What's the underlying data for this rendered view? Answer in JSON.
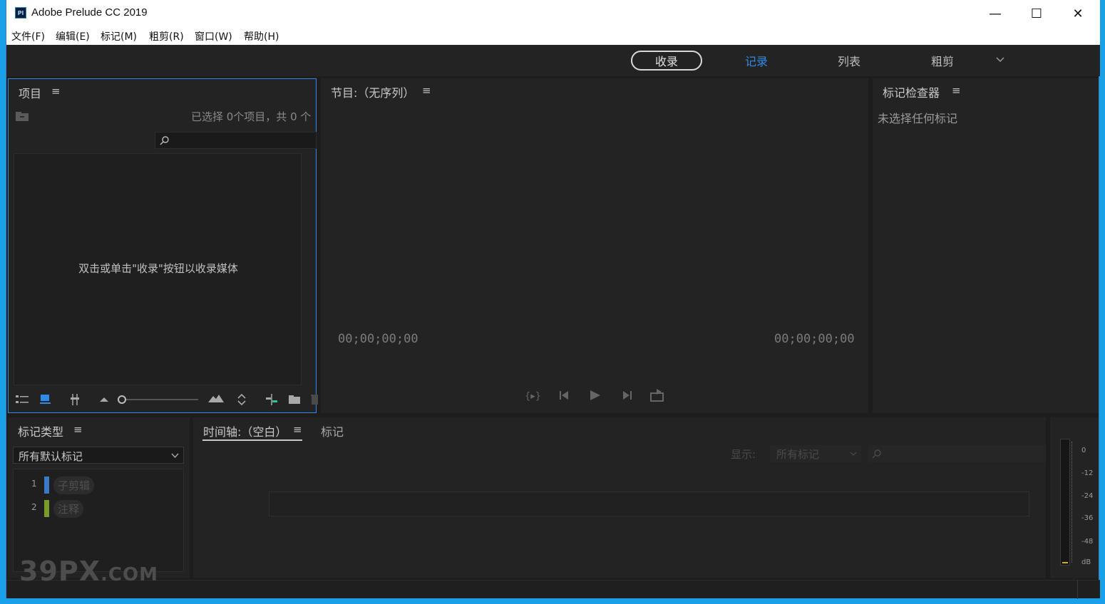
{
  "window": {
    "app_icon": "Pl",
    "title": "Adobe Prelude CC 2019",
    "controls": {
      "minimize": "—",
      "maximize": "☐",
      "close": "✕"
    }
  },
  "menu": [
    "文件(F)",
    "编辑(E)",
    "标记(M)",
    "粗剪(R)",
    "窗口(W)",
    "帮助(H)"
  ],
  "workspaces": {
    "ingest": "收录",
    "tabs": [
      "记录",
      "列表",
      "粗剪"
    ],
    "active": "记录",
    "dropdown_icon": "chevron-down-icon"
  },
  "project": {
    "title": "项目",
    "panel_menu": "≡",
    "selection_status": "已选择 0个项目，共 0 个",
    "search_placeholder": "",
    "empty_message": "双击或单击\"收录\"按钮以收录媒体"
  },
  "program": {
    "title": "节目:（无序列）",
    "panel_menu": "≡",
    "timecode_left": "00;00;00;00",
    "timecode_right": "00;00;00;00"
  },
  "inspector": {
    "title": "标记检查器",
    "panel_menu": "≡",
    "message": "未选择任何标记"
  },
  "marker_types": {
    "title": "标记类型",
    "panel_menu": "≡",
    "dropdown_value": "所有默认标记",
    "items": [
      {
        "num": "1",
        "label": "子剪辑",
        "color": "#3b78c8"
      },
      {
        "num": "2",
        "label": "注释",
        "color": "#7a9a2a"
      }
    ]
  },
  "timeline": {
    "title": "时间轴:（空白）",
    "panel_menu": "≡",
    "tab_markers": "标记",
    "show_label": "显示:",
    "show_value": "所有标记"
  },
  "meter": {
    "labels": [
      "0",
      "-12",
      "-24",
      "-36",
      "-48",
      "dB"
    ]
  },
  "watermark": {
    "main": "39PX",
    "suffix": ".COM"
  },
  "colors": {
    "accent": "#2d8ceb",
    "selected_panel_border": "#2d8ceb"
  }
}
